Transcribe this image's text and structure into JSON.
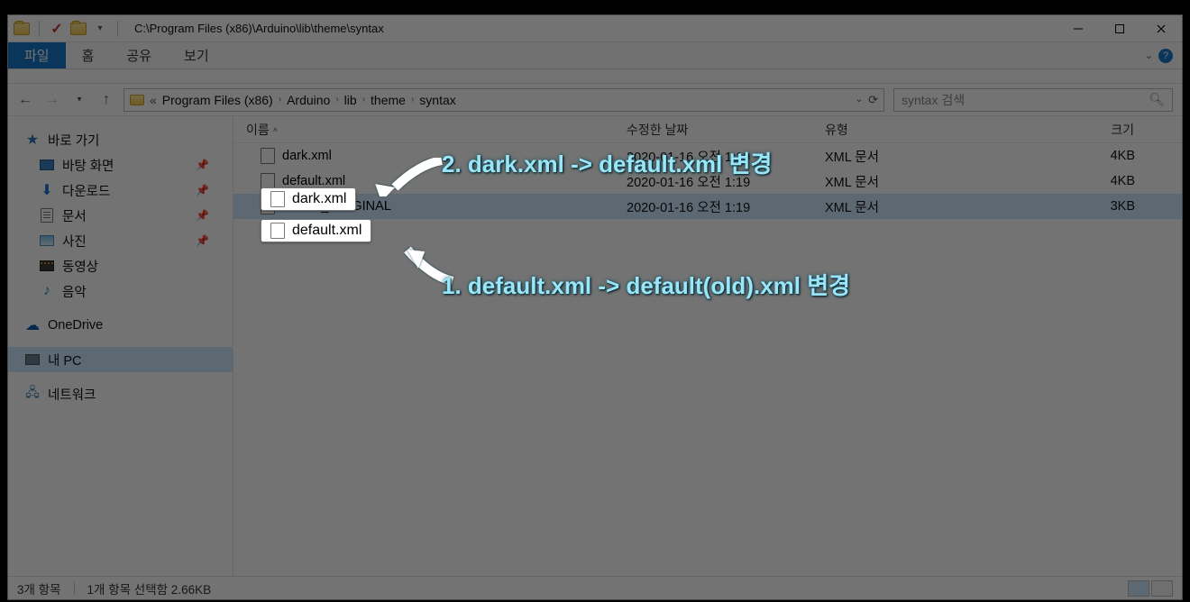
{
  "window": {
    "title_path": "C:\\Program Files (x86)\\Arduino\\lib\\theme\\syntax"
  },
  "ribbon": {
    "tabs": {
      "file": "파일",
      "home": "홈",
      "share": "공유",
      "view": "보기"
    }
  },
  "address": {
    "crumbs": [
      "Program Files (x86)",
      "Arduino",
      "lib",
      "theme",
      "syntax"
    ],
    "prefix": "«"
  },
  "search": {
    "placeholder": "syntax 검색"
  },
  "sidebar": {
    "quick_access": "바로 가기",
    "items": [
      {
        "label": "바탕 화면",
        "pinned": true
      },
      {
        "label": "다운로드",
        "pinned": true
      },
      {
        "label": "문서",
        "pinned": true
      },
      {
        "label": "사진",
        "pinned": true
      },
      {
        "label": "동영상",
        "pinned": false
      },
      {
        "label": "음악",
        "pinned": false
      }
    ],
    "onedrive": "OneDrive",
    "this_pc": "내 PC",
    "network": "네트워크"
  },
  "columns": {
    "name": "이름",
    "date": "수정한 날짜",
    "type": "유형",
    "size": "크기"
  },
  "files": [
    {
      "name": "dark.xml",
      "date": "2020-01-16 오전 1:19",
      "type": "XML 문서",
      "size": "4KB"
    },
    {
      "name": "default.xml",
      "date": "2020-01-16 오전 1:19",
      "type": "XML 문서",
      "size": "4KB"
    },
    {
      "name": "default_ORIGINAL",
      "date": "2020-01-16 오전 1:19",
      "type": "XML 문서",
      "size": "3KB"
    }
  ],
  "status": {
    "count": "3개 항목",
    "selection": "1개 항목 선택함 2.66KB"
  },
  "annotations": {
    "a2": "2. dark.xml -> default.xml 변경",
    "a1": "1. default.xml -> default(old).xml 변경"
  }
}
